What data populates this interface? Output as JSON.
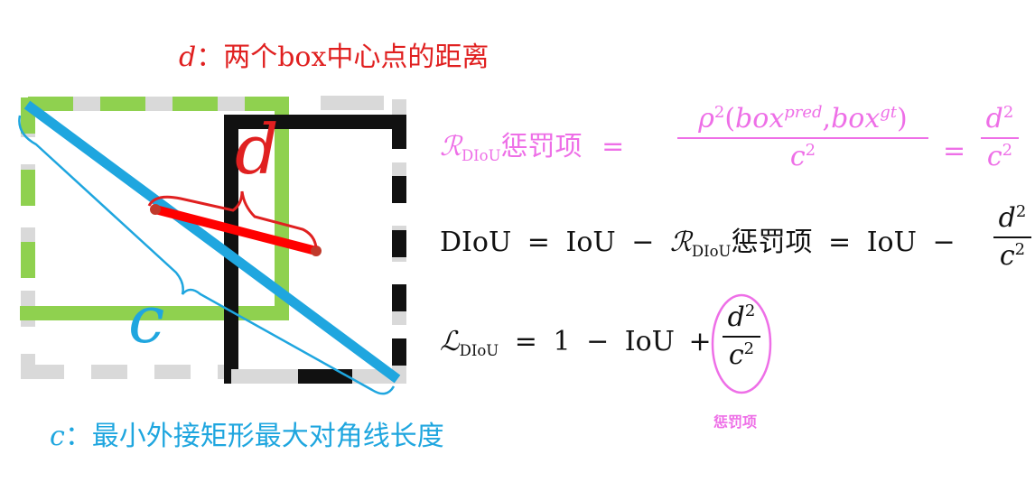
{
  "title_d": {
    "var": "d",
    "text": "：两个box中心点的距离"
  },
  "label_c": {
    "var": "c",
    "text": "：最小外接矩形最大对角线长度"
  },
  "diagram": {
    "d_letter": "d",
    "c_letter": "c"
  },
  "formula1": {
    "lhs_script": "ℛ",
    "lhs_sub": "DIoU",
    "lhs_text": "惩罚项",
    "eq": "=",
    "num_rho": "ρ",
    "num_sup": "2",
    "num_box1": "box",
    "num_sup1": "pred",
    "num_comma": ",",
    "num_box2": "box",
    "num_sup2": "gt",
    "den": "c",
    "den_sup": "2",
    "eq2": "=",
    "frac2_num": "d",
    "frac2_den": "c"
  },
  "formula2": {
    "lhs": "DIoU",
    "eq": "=",
    "iou": "IoU",
    "minus": "−",
    "r_script": "ℛ",
    "r_sub": "DIoU",
    "r_text": "惩罚项",
    "eq2": "=",
    "iou2": "IoU",
    "minus2": "−",
    "frac_num": "d",
    "frac_den": "c"
  },
  "formula3": {
    "lhs_script": "ℒ",
    "lhs_sub": "DIoU",
    "eq": "=",
    "one": "1",
    "minus": "−",
    "iou": "IoU",
    "plus": "+",
    "frac_num": "d",
    "frac_den": "c"
  },
  "penalty_label": "惩罚项",
  "colors": {
    "red": "#e02020",
    "blue": "#1fa6df",
    "pink": "#ee6fe7",
    "green": "#8fd14f",
    "gray": "#d9d9d9",
    "black": "#111111"
  }
}
